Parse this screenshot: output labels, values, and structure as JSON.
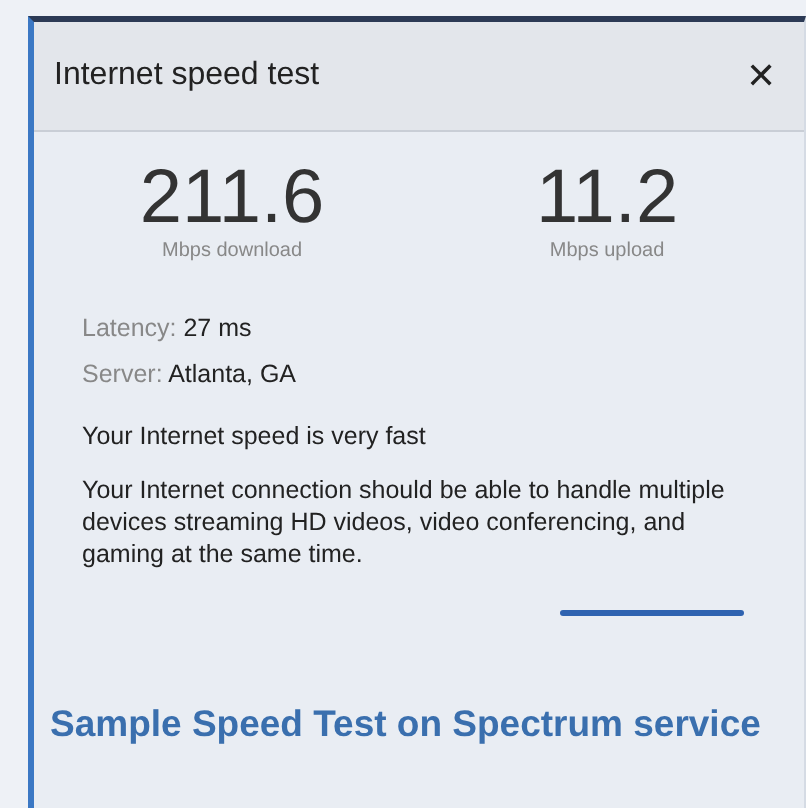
{
  "dialog": {
    "title": "Internet speed test",
    "close": "✕"
  },
  "results": [
    {
      "value": "211.6",
      "label": "Mbps download"
    },
    {
      "value": "11.2",
      "label": "Mbps upload"
    }
  ],
  "details": [
    {
      "label": "Latency: ",
      "value": "27 ms"
    },
    {
      "label": "Server: ",
      "value": "Atlanta, GA"
    }
  ],
  "summary": "Your Internet speed is very fast",
  "description": "Your Internet connection should be able to handle multiple devices streaming HD videos, video conferencing, and gaming at the same time.",
  "caption": "Sample Speed Test on Spectrum service"
}
